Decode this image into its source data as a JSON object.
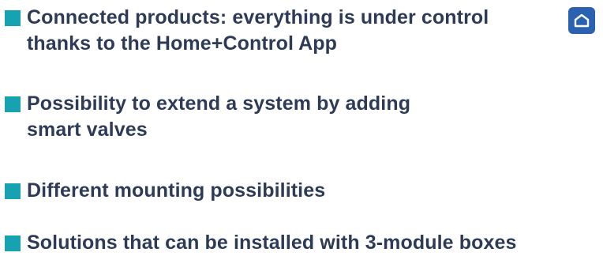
{
  "features": [
    {
      "lines": [
        "Connected products: everything is under control",
        "thanks to the Home+Control App"
      ]
    },
    {
      "lines": [
        "Possibility to extend a system by adding",
        "smart valves"
      ]
    },
    {
      "lines": [
        "Different mounting possibilities"
      ]
    },
    {
      "lines": [
        "Solutions that can be installed with 3-module boxes"
      ]
    }
  ],
  "icons": {
    "bullet": "square-bullet-icon",
    "app": "home-control-app-icon"
  },
  "colors": {
    "bullet": "#17a2b2",
    "text": "#2d3b57",
    "app_icon_bg": "#2a61b0",
    "app_icon_fg": "#ffffff",
    "background": "#ffffff"
  }
}
